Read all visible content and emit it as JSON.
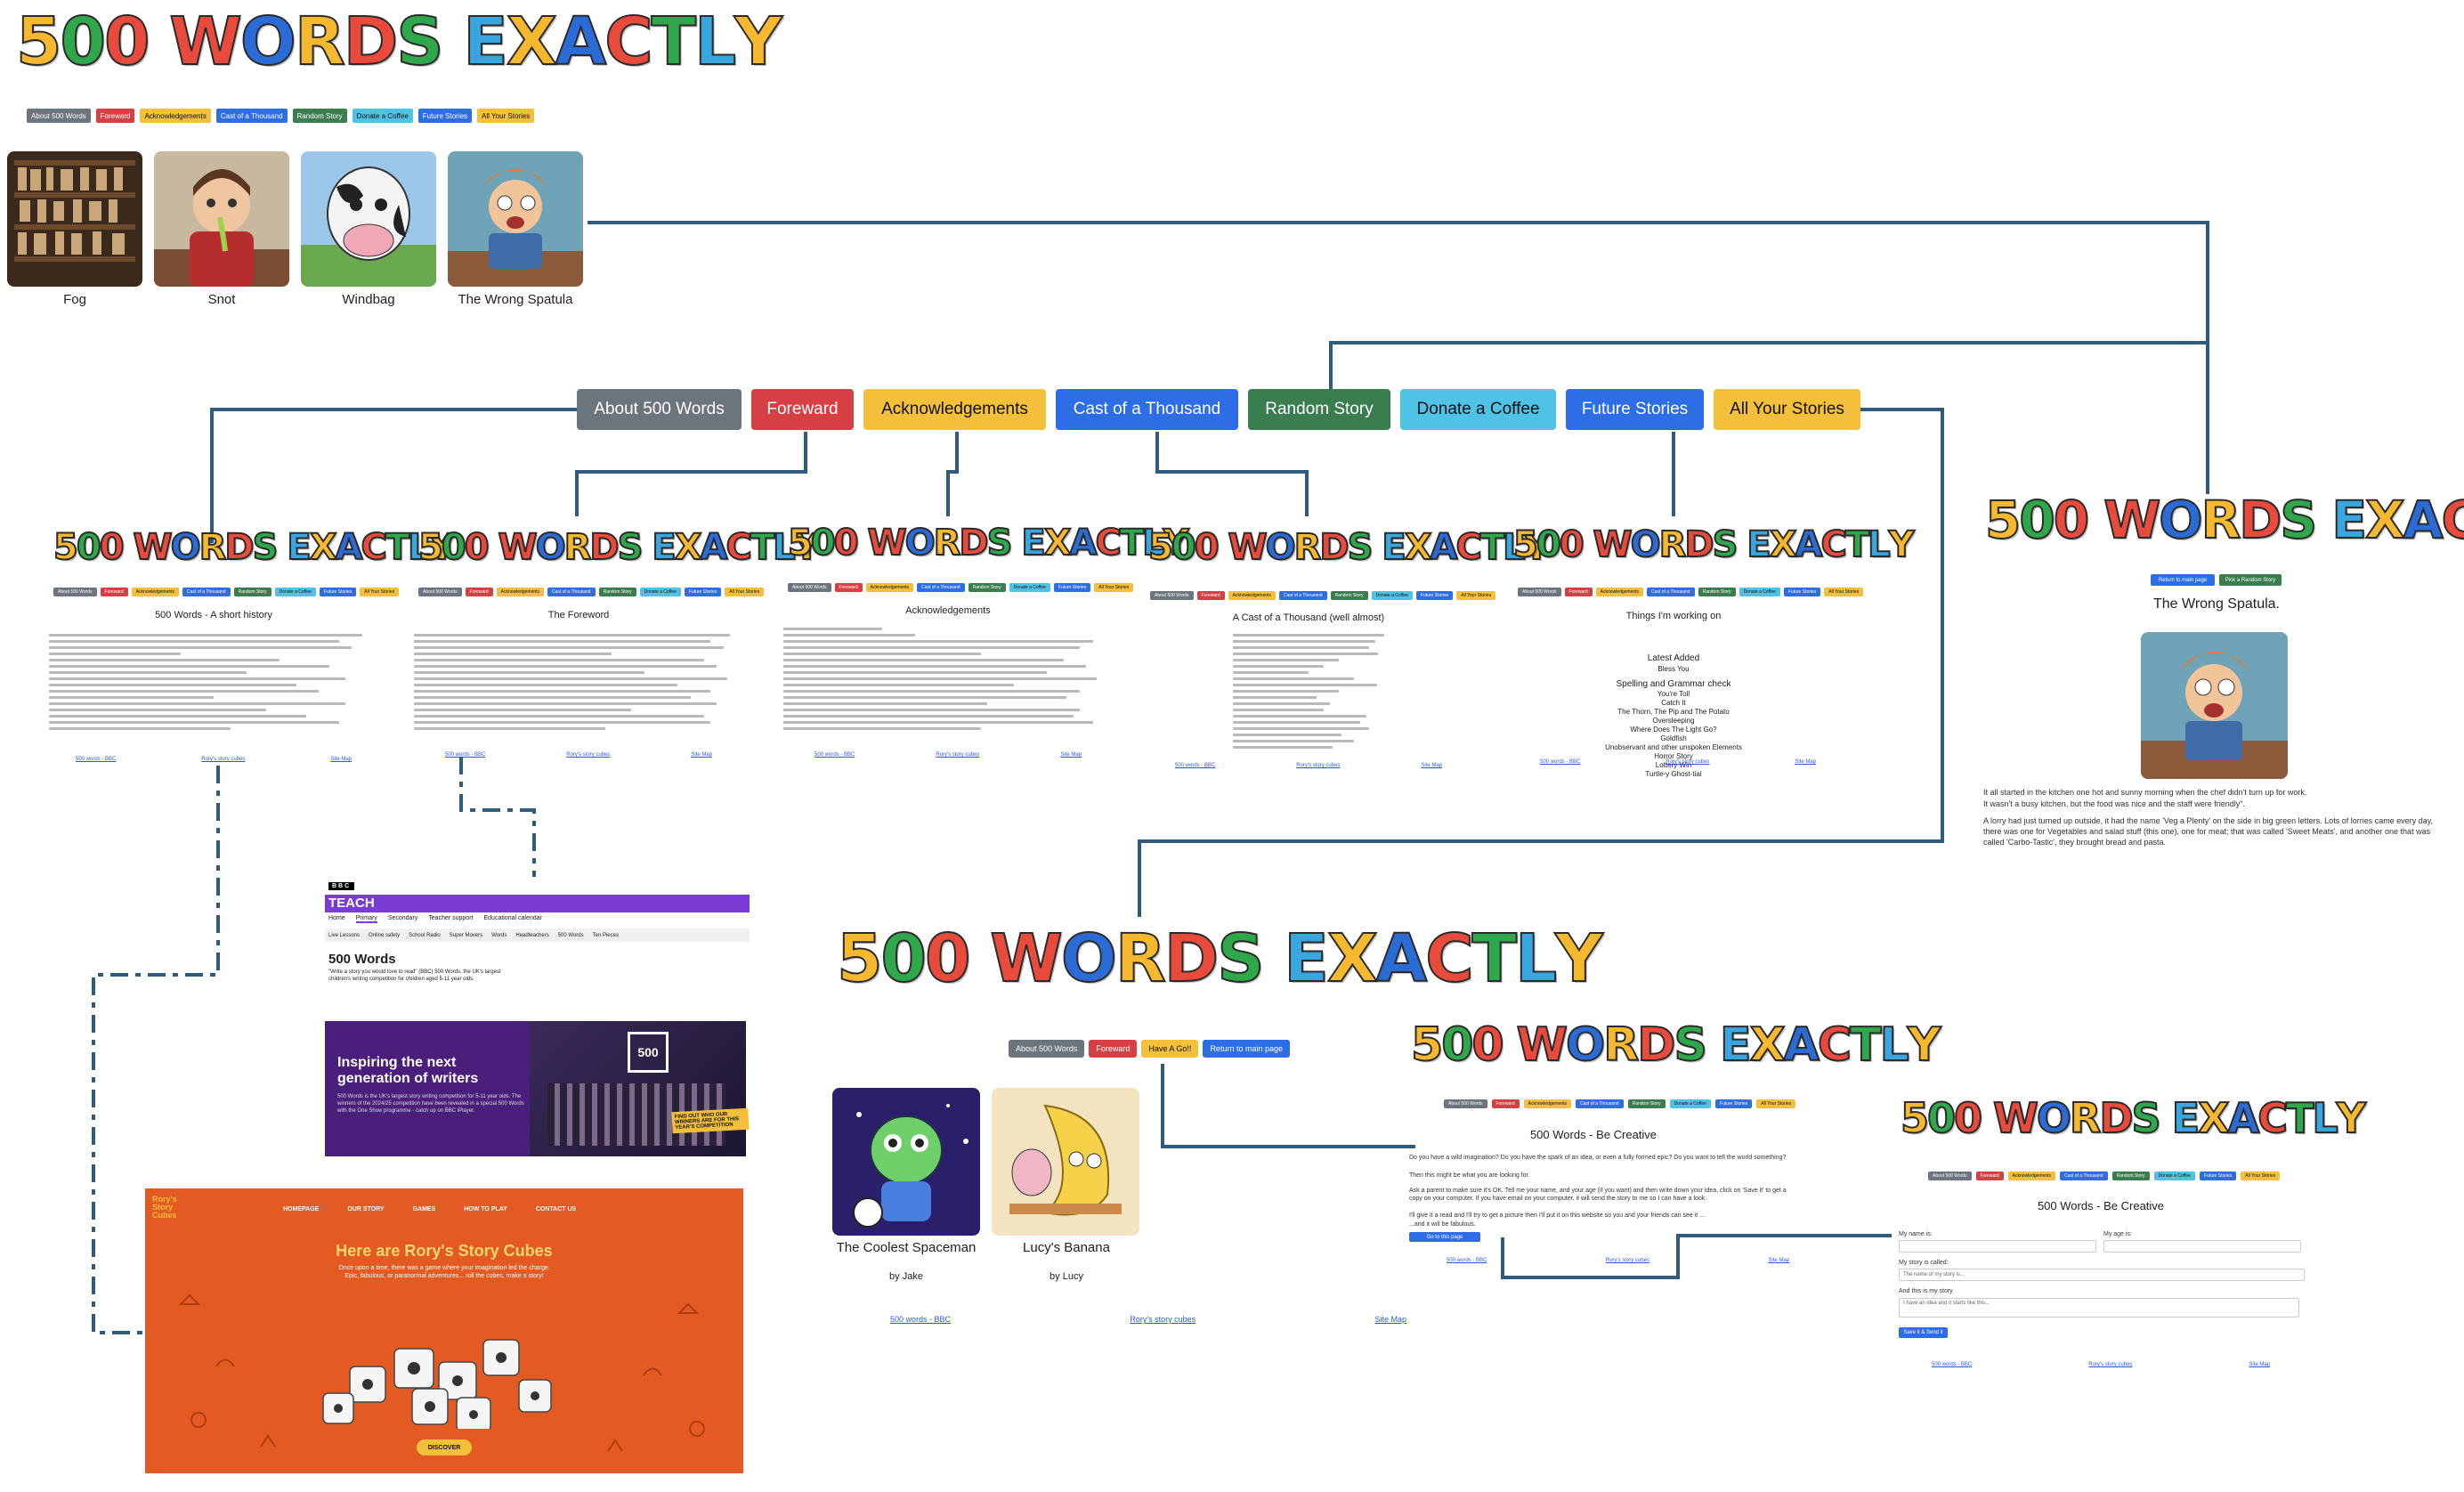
{
  "logo": {
    "text": "500 WORDS EXACTLY",
    "letter_colors": [
      "#f5b82e",
      "#2ea84a",
      "#e84a3c",
      "#e84a3c",
      "#2b6bd6",
      "#f5b82e",
      "#e84a3c",
      "#2ea84a",
      "#3aa6e0",
      "#f5b82e",
      "#2b6bd6",
      "#e84a3c",
      "#2ea84a",
      "#3aa6e0",
      "#f5b82e",
      "#2ea84a",
      "#e84a3c"
    ]
  },
  "colors": {
    "wire": "#2f5c7e",
    "grey": "#6c757d",
    "red": "#d64045",
    "yellow": "#f4bf3a",
    "blue": "#2d6ee6",
    "green": "#3a7d4f",
    "cyan": "#4fc3e6",
    "bbc_purple": "#7a3cd4",
    "rory_orange": "#e35a22"
  },
  "nav": {
    "items": [
      {
        "label": "About 500 Words",
        "color": "grey"
      },
      {
        "label": "Foreward",
        "color": "red"
      },
      {
        "label": "Acknowledgements",
        "color": "yellow"
      },
      {
        "label": "Cast of a Thousand",
        "color": "blue"
      },
      {
        "label": "Random Story",
        "color": "green"
      },
      {
        "label": "Donate a Coffee",
        "color": "cyan"
      },
      {
        "label": "Future Stories",
        "color": "blue"
      },
      {
        "label": "All Your Stories",
        "color": "yellow"
      }
    ]
  },
  "stories": [
    {
      "caption": "Fog",
      "icon": "shelves-image"
    },
    {
      "caption": "Snot",
      "icon": "boy-image"
    },
    {
      "caption": "Windbag",
      "icon": "cow-image"
    },
    {
      "caption": "The Wrong Spatula",
      "icon": "chef-image"
    }
  ],
  "pages": {
    "about_title": "500 Words - A short history",
    "foreword_title": "The Foreword",
    "ack_title": "Acknowledgements",
    "cast_title": "A Cast of a Thousand (well almost)",
    "future_title": "Things I'm working on",
    "future_items": [
      "Latest Added",
      "Bless You",
      "Spelling and Grammar check",
      "You're Toll",
      "Catch It",
      "The Thorn, The Pip and The Potato",
      "Oversleeping",
      "Where Does The Light Go?",
      "Goldfish",
      "Unobservant and other unspoken Elements",
      "Horror Story",
      "Lottery Win",
      "Turtle-y Ghost-tial"
    ],
    "footer_links": [
      "500 words - BBC",
      "Rory's story cubes",
      "Site Map"
    ]
  },
  "random_story": {
    "btn_return": "Return to main page",
    "btn_random": "Pick a Random Story",
    "title": "The Wrong Spatula.",
    "text1": "It all started in the kitchen one hot and sunny morning when the chef didn't turn up for work.",
    "text2": "It wasn't a busy kitchen, but the food was nice and the staff were friendly\".",
    "text3": "A lorry had just turned up outside, it had the name 'Veg a Plenty' on the side in big green letters. Lots of lorries came every day, there was one for Vegetables and salad stuff (this one), one for meat; that was called 'Sweet Meats', and another one that was called 'Carbo-Tastic', they brought bread and pasta."
  },
  "bbc": {
    "logo": "BBC",
    "section": "TEACH",
    "nav": [
      "Home",
      "Primary",
      "Secondary",
      "Teacher support",
      "Educational calendar"
    ],
    "subnav": [
      "Live Lessons",
      "Online safety",
      "School Radio",
      "Super Movers",
      "Words",
      "Headteachers",
      "500 Words",
      "Ten Pieces"
    ],
    "heading": "500 Words",
    "intro": "\"Write a story you would love to read\" (BBC) 500 Words, the UK's largest children's writing competition for children aged 5-11 year olds.",
    "banner_title": "Inspiring the next generation of writers",
    "banner_text": "500 Words is the UK's largest story writing competition for 5-11 year olds. The winners of the 2024/25 competition have been revealed in a special 500 Words with the One Show programme - catch up on BBC iPlayer.",
    "banner_badge": "500",
    "banner_cta": "FIND OUT WHO OUR WINNERS ARE FOR THIS YEAR'S COMPETITION"
  },
  "rory": {
    "logo": "Rory's Story Cubes",
    "nav": [
      "HOMEPAGE",
      "OUR STORY",
      "GAMES",
      "HOW TO PLAY",
      "CONTACT US"
    ],
    "heading": "Here are Rory's Story Cubes",
    "text": "Once upon a time, there was a game where your imagination led the charge. Epic, fabulous, or paranormal adventures... roll the cubes, make a story!",
    "cta": "DISCOVER"
  },
  "all_stories": {
    "nav": [
      {
        "label": "About 500 Words",
        "color": "grey"
      },
      {
        "label": "Foreward",
        "color": "red"
      },
      {
        "label": "Have A Go!!",
        "color": "yellow"
      },
      {
        "label": "Return to main page",
        "color": "blue"
      }
    ],
    "cards": [
      {
        "title": "The Coolest Spaceman",
        "author": "by Jake"
      },
      {
        "title": "Lucy's Banana",
        "author": "by Lucy"
      }
    ],
    "footer_links": [
      "500 words - BBC",
      "Rory's story cubes",
      "Site Map"
    ]
  },
  "create1": {
    "title": "500 Words - Be Creative",
    "p1": "Do you have a wild imagination? Do you have the spark of an idea, or even a fully formed epic? Do you want to tell the world something?",
    "p2": "Then this might be what you are looking for.",
    "p3": "Ask a parent to make sure it's OK. Tell me your name, and your age (if you want) and then write down your idea, click on 'Save it' to get a copy on your computer. If you have email on your computer, it will send the story to me so I can have a look.",
    "p4": "I'll give it a read and I'll try to get a picture then I'll put it on this website so you and your friends can see it ...",
    "p5": "...and it will be fabulous.",
    "btn": "Go to this page",
    "footer_links": [
      "500 words - BBC",
      "Rory's story cubes",
      "Site Map"
    ]
  },
  "create2": {
    "title": "500 Words - Be Creative",
    "name_label": "My name is:",
    "age_label": "My age is:",
    "story_called_label": "My story is called:",
    "story_called_placeholder": "The name of my story is...",
    "story_label": "And this is my story",
    "story_placeholder": "I have an idea and it starts like this...",
    "send_btn": "Save it & Send it",
    "footer_links": [
      "500 words - BBC",
      "Rory's story cubes",
      "Site Map"
    ]
  }
}
